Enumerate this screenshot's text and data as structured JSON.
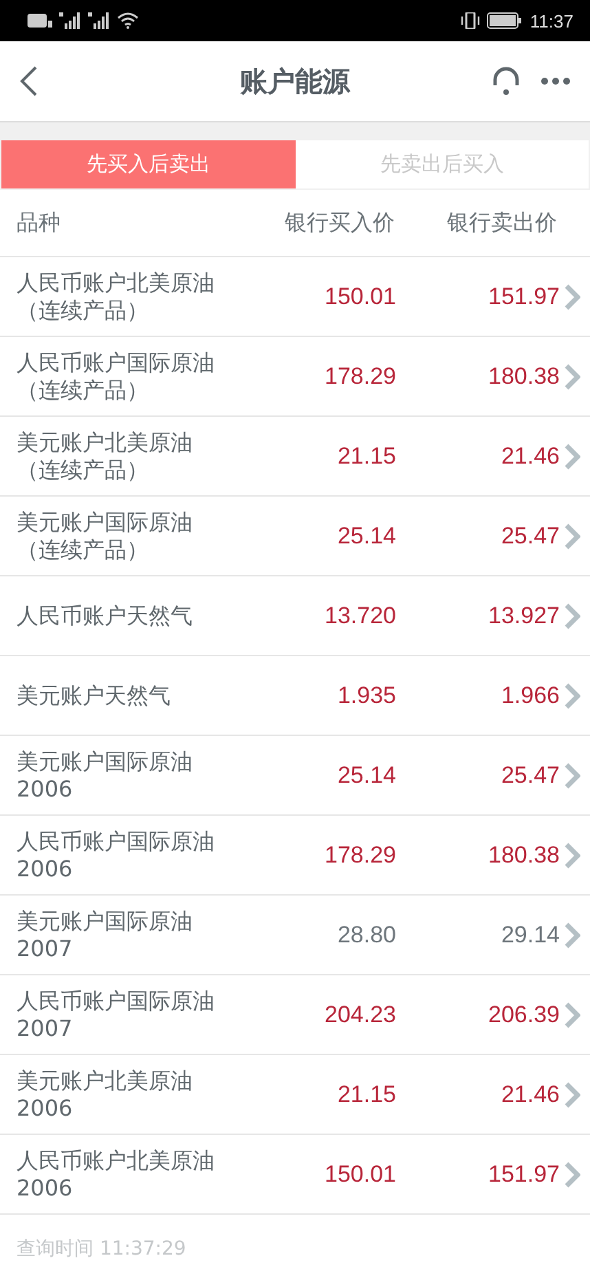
{
  "status_bar": {
    "time": "11:37"
  },
  "nav": {
    "title": "账户能源"
  },
  "tabs": [
    {
      "label": "先买入后卖出",
      "selected": true
    },
    {
      "label": "先卖出后买入",
      "selected": false
    }
  ],
  "table": {
    "columns": [
      "品种",
      "银行买入价",
      "银行卖出价"
    ],
    "rows": [
      {
        "name": "人民币账户北美原油",
        "sub": "（连续产品）",
        "buy": "150.01",
        "sell": "151.97",
        "color": "#b8263a"
      },
      {
        "name": "人民币账户国际原油",
        "sub": "（连续产品）",
        "buy": "178.29",
        "sell": "180.38",
        "color": "#b8263a"
      },
      {
        "name": "美元账户北美原油",
        "sub": "（连续产品）",
        "buy": "21.15",
        "sell": "21.46",
        "color": "#b8263a"
      },
      {
        "name": "美元账户国际原油",
        "sub": "（连续产品）",
        "buy": "25.14",
        "sell": "25.47",
        "color": "#b8263a"
      },
      {
        "name": "人民币账户天然气",
        "buy": "13.720",
        "sell": "13.927",
        "color": "#b8263a"
      },
      {
        "name": "美元账户天然气",
        "buy": "1.935",
        "sell": "1.966",
        "color": "#b8263a"
      },
      {
        "name": "美元账户国际原油",
        "sub": "2006",
        "buy": "25.14",
        "sell": "25.47",
        "color": "#b8263a"
      },
      {
        "name": "人民币账户国际原油",
        "sub": "2006",
        "buy": "178.29",
        "sell": "180.38",
        "color": "#b8263a"
      },
      {
        "name": "美元账户国际原油",
        "sub": "2007",
        "buy": "28.80",
        "sell": "29.14",
        "color": "#6e767c"
      },
      {
        "name": "人民币账户国际原油",
        "sub": "2007",
        "buy": "204.23",
        "sell": "206.39",
        "color": "#b8263a"
      },
      {
        "name": "美元账户北美原油",
        "sub": "2006",
        "buy": "21.15",
        "sell": "21.46",
        "color": "#b8263a"
      },
      {
        "name": "人民币账户北美原油",
        "sub": "2006",
        "buy": "150.01",
        "sell": "151.97",
        "color": "#b8263a"
      }
    ]
  },
  "footer": {
    "query_time": "查询时间 11:37:29"
  }
}
